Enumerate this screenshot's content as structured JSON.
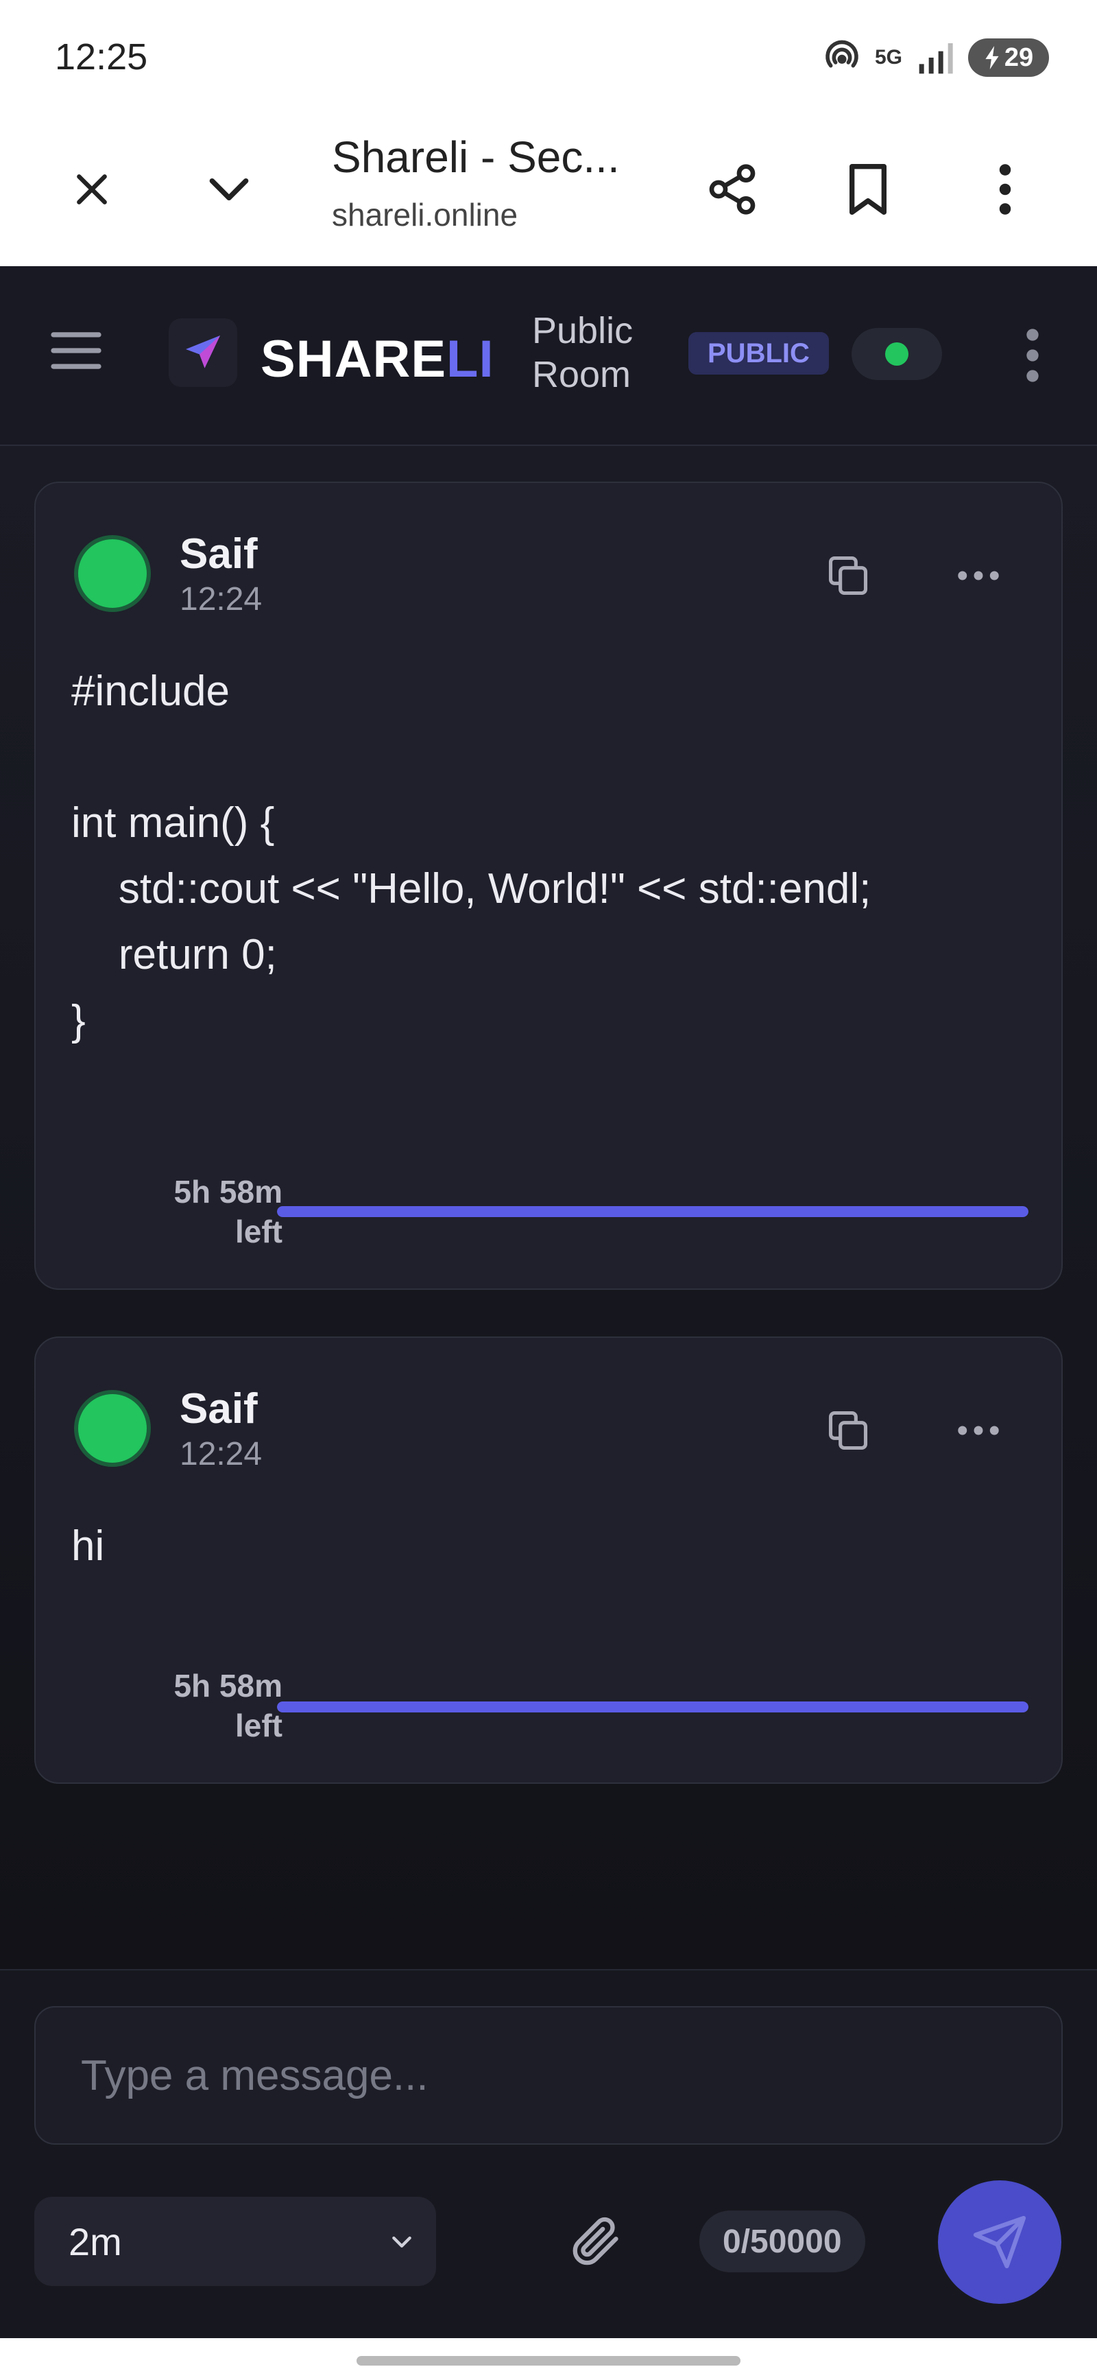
{
  "status_bar": {
    "time": "12:25",
    "network": "5G",
    "battery": "29"
  },
  "browser": {
    "title": "Shareli - Sec...",
    "url": "shareli.online",
    "icons": [
      "close-icon",
      "chevron-down-icon",
      "share-icon",
      "bookmark-icon",
      "more-vertical-icon"
    ]
  },
  "header": {
    "brand_part1": "SHARE",
    "brand_part2": "LI",
    "room_line1": "Public",
    "room_line2": "Room",
    "badge": "PUBLIC",
    "connection_color": "#22c55e"
  },
  "messages": [
    {
      "sender": "Saif",
      "time": "12:24",
      "body": "#include\n\nint main() {\n    std::cout << \"Hello, World!\" << std::endl;\n    return 0;\n}",
      "expiry_line1": "5h 58m",
      "expiry_line2": "left",
      "remaining_fraction": 1.0
    },
    {
      "sender": "Saif",
      "time": "12:24",
      "body": "hi",
      "expiry_line1": "5h 58m",
      "expiry_line2": "left",
      "remaining_fraction": 1.0
    }
  ],
  "composer": {
    "placeholder": "Type a message...",
    "ttl_value": "2m",
    "counter": "0/50000"
  },
  "colors": {
    "accent": "#5b5ce6",
    "avatar": "#22c55e",
    "background": "#1a1b24"
  }
}
